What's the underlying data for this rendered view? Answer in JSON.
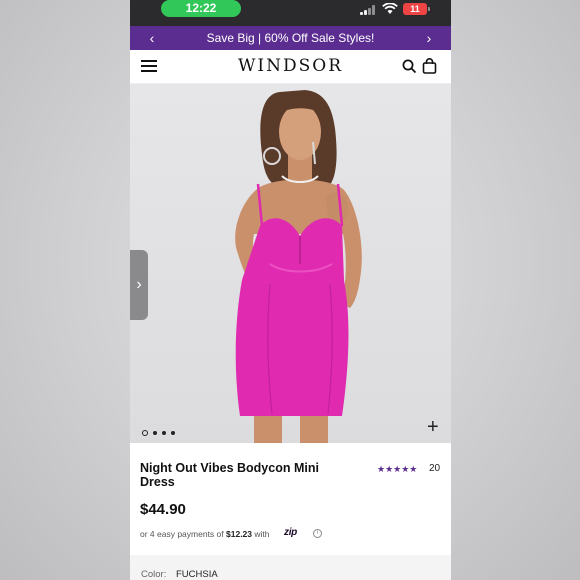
{
  "status_bar": {
    "time": "12:22",
    "battery": "11"
  },
  "promo": {
    "text": "Save Big | 60% Off Sale Styles!"
  },
  "header": {
    "logo": "WINDSOR"
  },
  "hero": {
    "carousel_count": 4,
    "active_index": 0,
    "dress_color": "#e02ab0"
  },
  "product": {
    "title": "Night Out Vibes Bodycon Mini Dress",
    "rating_stars": "★★★★★",
    "rating": 5,
    "review_count": "20",
    "price": "$44.90",
    "installments_prefix": "or 4 easy payments of",
    "installment_amount": "$12.23",
    "installments_with": "with",
    "pay_provider": "zip",
    "color_label": "Color:",
    "color_value": "FUCHSIA"
  },
  "colors": {
    "promo_bg": "#5c2d91",
    "star": "#5c2d91",
    "time_pill": "#32c759"
  }
}
